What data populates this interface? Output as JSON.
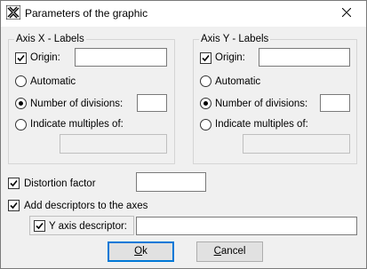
{
  "window": {
    "title": "Parameters of the graphic",
    "close_symbol": "✕"
  },
  "axis_x": {
    "legend": "Axis X - Labels",
    "origin_label": "Origin:",
    "origin_checked": true,
    "origin_value": "",
    "automatic_label": "Automatic",
    "num_divisions_label": "Number of divisions:",
    "num_divisions_value": "",
    "multiples_label": "Indicate multiples of:",
    "multiples_value": "",
    "selected": "num_divisions"
  },
  "axis_y": {
    "legend": "Axis Y - Labels",
    "origin_label": "Origin:",
    "origin_checked": true,
    "origin_value": "",
    "automatic_label": "Automatic",
    "num_divisions_label": "Number of divisions:",
    "num_divisions_value": "",
    "multiples_label": "Indicate multiples of:",
    "multiples_value": "",
    "selected": "num_divisions"
  },
  "distortion": {
    "label": "Distortion factor",
    "checked": true,
    "value": ""
  },
  "descriptors": {
    "label": "Add descriptors to the axes",
    "checked": true,
    "y_label": "Y axis descriptor:",
    "y_checked": true,
    "y_value": ""
  },
  "buttons": {
    "ok_underlined": "O",
    "ok_rest": "k",
    "cancel_underlined": "C",
    "cancel_rest": "ancel"
  },
  "icons": {
    "app": "app-logo-icon",
    "close": "close-icon",
    "checkmark": "checkmark-icon"
  }
}
